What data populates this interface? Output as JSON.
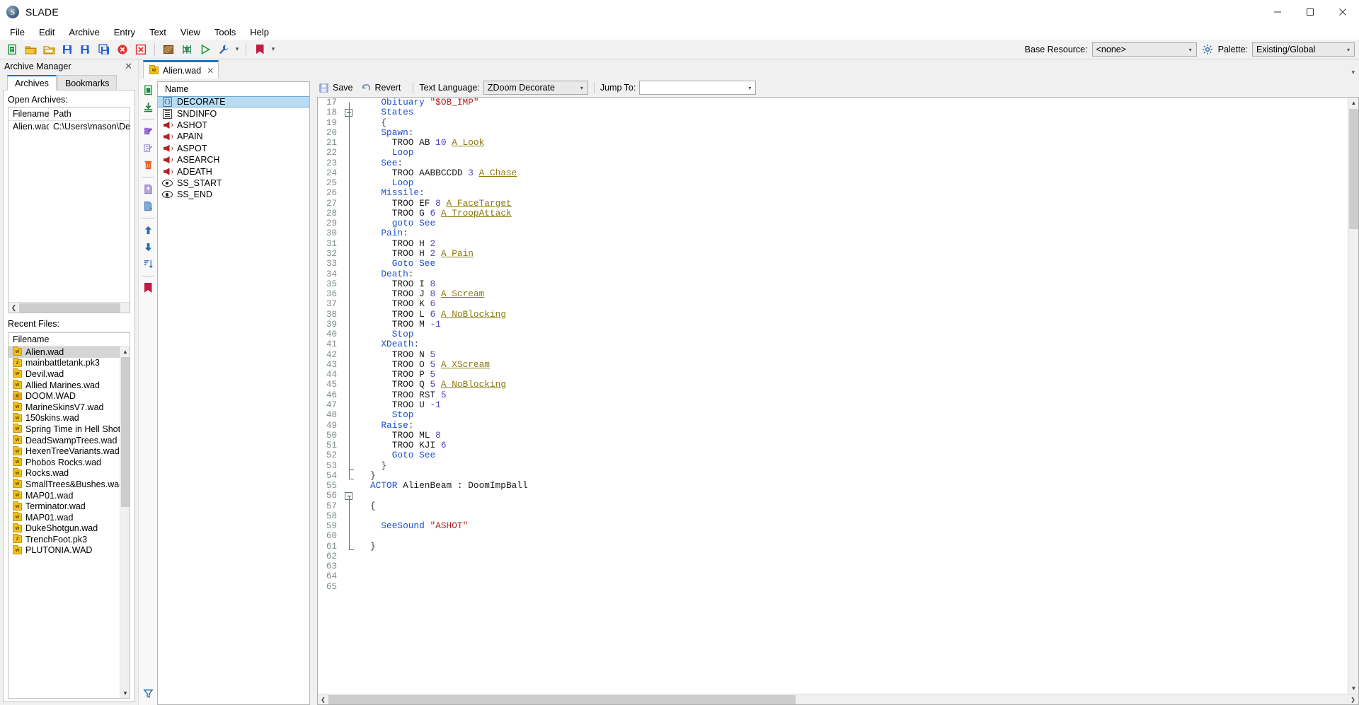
{
  "window": {
    "title": "SLADE",
    "app_icon": "slade-logo-icon",
    "buttons": {
      "minimize": "minimize-icon",
      "maximize": "maximize-icon",
      "close": "close-icon"
    }
  },
  "menubar": {
    "items": [
      "File",
      "Edit",
      "Archive",
      "Entry",
      "Text",
      "View",
      "Tools",
      "Help"
    ]
  },
  "toolbar": {
    "icons": [
      "new-archive-icon",
      "open-archive-icon",
      "open-folder-icon",
      "save-icon",
      "save-as-icon",
      "save-all-icon",
      "close-archive-icon",
      "close-all-icon",
      "texture-editor-icon",
      "map-editor-icon",
      "run-icon",
      "maintenance-icon",
      "bookmarks-icon"
    ],
    "base_resource_label": "Base Resource:",
    "base_resource_value": "<none>",
    "gear_icon": "gear-icon",
    "palette_label": "Palette:",
    "palette_value": "Existing/Global"
  },
  "archive_manager": {
    "title": "Archive Manager",
    "close_icon": "close-icon",
    "tabs": [
      {
        "label": "Archives",
        "active": true
      },
      {
        "label": "Bookmarks",
        "active": false
      }
    ],
    "open_archives": {
      "label": "Open Archives:",
      "columns": [
        "Filename",
        "Path"
      ],
      "rows": [
        {
          "filename": "Alien.wad",
          "path": "C:\\Users\\mason\\Desktop",
          "icon": "wad-file-icon"
        }
      ],
      "hscroll": {
        "left_arrow": "chevron-left-icon",
        "right_arrow": "chevron-right-icon"
      }
    },
    "recent_files": {
      "label": "Recent Files:",
      "columns": [
        "Filename"
      ],
      "rows": [
        {
          "name": "Alien.wad",
          "icon": "wad-file-icon",
          "badge": "w",
          "selected": true
        },
        {
          "name": "mainbattletank.pk3",
          "icon": "pk3-file-icon",
          "badge": "z",
          "selected": false
        },
        {
          "name": "Devil.wad",
          "icon": "wad-file-icon",
          "badge": "w",
          "selected": false
        },
        {
          "name": "Allied Marines.wad",
          "icon": "wad-file-icon",
          "badge": "w",
          "selected": false
        },
        {
          "name": "DOOM.WAD",
          "icon": "iwad-file-icon",
          "badge": "A",
          "selected": false
        },
        {
          "name": "MarineSkinsV7.wad",
          "icon": "wad-file-icon",
          "badge": "w",
          "selected": false
        },
        {
          "name": "150skins.wad",
          "icon": "wad-file-icon",
          "badge": "w",
          "selected": false
        },
        {
          "name": "Spring Time in Hell Shotgun.wa",
          "icon": "wad-file-icon",
          "badge": "w",
          "selected": false
        },
        {
          "name": "DeadSwampTrees.wad",
          "icon": "wad-file-icon",
          "badge": "w",
          "selected": false
        },
        {
          "name": "HexenTreeVariants.wad",
          "icon": "wad-file-icon",
          "badge": "w",
          "selected": false
        },
        {
          "name": "Phobos Rocks.wad",
          "icon": "wad-file-icon",
          "badge": "w",
          "selected": false
        },
        {
          "name": "Rocks.wad",
          "icon": "wad-file-icon",
          "badge": "w",
          "selected": false
        },
        {
          "name": "SmallTrees&Bushes.wad",
          "icon": "wad-file-icon",
          "badge": "w",
          "selected": false
        },
        {
          "name": "MAP01.wad",
          "icon": "wad-file-icon",
          "badge": "w",
          "selected": false
        },
        {
          "name": "Terminator.wad",
          "icon": "wad-file-icon",
          "badge": "w",
          "selected": false
        },
        {
          "name": "MAP01.wad",
          "icon": "wad-file-icon",
          "badge": "w",
          "selected": false
        },
        {
          "name": "DukeShotgun.wad",
          "icon": "wad-file-icon",
          "badge": "w",
          "selected": false
        },
        {
          "name": "TrenchFoot.pk3",
          "icon": "pk3-file-icon",
          "badge": "z",
          "selected": false
        },
        {
          "name": "PLUTONIA.WAD",
          "icon": "wad-file-icon",
          "badge": "w",
          "selected": false
        }
      ]
    }
  },
  "archive_tab": {
    "label": "Alien.wad",
    "icon": "wad-file-icon",
    "close_icon": "close-icon",
    "collapse_icon": "chevron-down-icon"
  },
  "entry_toolbar": {
    "icons": [
      "new-entry-icon",
      "import-entry-icon",
      "rename-entry-icon",
      "edit-entry-icon",
      "delete-entry-icon",
      "export-entry-icon",
      "export-entry-as-icon",
      "move-up-icon",
      "move-down-icon",
      "sort-icon",
      "bookmark-icon",
      "filter-icon"
    ]
  },
  "entry_list": {
    "column": "Name",
    "entries": [
      {
        "name": "DECORATE",
        "icon": "code-entry-icon",
        "selected": true
      },
      {
        "name": "SNDINFO",
        "icon": "text-entry-icon",
        "selected": false
      },
      {
        "name": "ASHOT",
        "icon": "sound-entry-icon",
        "selected": false
      },
      {
        "name": "APAIN",
        "icon": "sound-entry-icon",
        "selected": false
      },
      {
        "name": "ASPOT",
        "icon": "sound-entry-icon",
        "selected": false
      },
      {
        "name": "ASEARCH",
        "icon": "sound-entry-icon",
        "selected": false
      },
      {
        "name": "ADEATH",
        "icon": "sound-entry-icon",
        "selected": false
      },
      {
        "name": "SS_START",
        "icon": "marker-entry-icon",
        "selected": false
      },
      {
        "name": "SS_END",
        "icon": "marker-entry-icon",
        "selected": false
      }
    ]
  },
  "editor_toolbar": {
    "save_label": "Save",
    "save_icon": "save-icon",
    "revert_label": "Revert",
    "revert_icon": "revert-icon",
    "language_label": "Text Language:",
    "language_value": "ZDoom Decorate",
    "jump_to_label": "Jump To:",
    "jump_to_value": ""
  },
  "code": {
    "first_line": 17,
    "last_line": 65,
    "lines": [
      {
        "n": 17,
        "tokens": [
          {
            "t": "Obituary ",
            "c": "kw"
          },
          {
            "t": "\"$OB_IMP\"",
            "c": "str"
          }
        ],
        "indent": 1
      },
      {
        "n": 18,
        "tokens": [
          {
            "t": "States",
            "c": "kw"
          }
        ],
        "indent": 1,
        "fold": "open"
      },
      {
        "n": 19,
        "tokens": [
          {
            "t": "{",
            "c": "punct"
          }
        ],
        "indent": 1
      },
      {
        "n": 20,
        "tokens": [
          {
            "t": "Spawn",
            "c": "kw"
          },
          {
            "t": ":",
            "c": "punct"
          }
        ],
        "indent": 1
      },
      {
        "n": 21,
        "tokens": [
          {
            "t": "TROO AB ",
            "c": "plain"
          },
          {
            "t": "10",
            "c": "num"
          },
          {
            "t": " ",
            "c": "plain"
          },
          {
            "t": "A_Look",
            "c": "fn"
          }
        ],
        "indent": 2
      },
      {
        "n": 22,
        "tokens": [
          {
            "t": "Loop",
            "c": "kw"
          }
        ],
        "indent": 2
      },
      {
        "n": 23,
        "tokens": [
          {
            "t": "See",
            "c": "kw"
          },
          {
            "t": ":",
            "c": "punct"
          }
        ],
        "indent": 1
      },
      {
        "n": 24,
        "tokens": [
          {
            "t": "TROO AABBCCDD ",
            "c": "plain"
          },
          {
            "t": "3",
            "c": "num"
          },
          {
            "t": " ",
            "c": "plain"
          },
          {
            "t": "A_Chase",
            "c": "fn"
          }
        ],
        "indent": 2
      },
      {
        "n": 25,
        "tokens": [
          {
            "t": "Loop",
            "c": "kw"
          }
        ],
        "indent": 2
      },
      {
        "n": 26,
        "tokens": [
          {
            "t": "Missile",
            "c": "kw"
          },
          {
            "t": ":",
            "c": "punct"
          }
        ],
        "indent": 1
      },
      {
        "n": 27,
        "tokens": [
          {
            "t": "TROO EF ",
            "c": "plain"
          },
          {
            "t": "8",
            "c": "num"
          },
          {
            "t": " ",
            "c": "plain"
          },
          {
            "t": "A_FaceTarget",
            "c": "fn"
          }
        ],
        "indent": 2
      },
      {
        "n": 28,
        "tokens": [
          {
            "t": "TROO G ",
            "c": "plain"
          },
          {
            "t": "6",
            "c": "num"
          },
          {
            "t": " ",
            "c": "plain"
          },
          {
            "t": "A_TroopAttack",
            "c": "fn"
          }
        ],
        "indent": 2
      },
      {
        "n": 29,
        "tokens": [
          {
            "t": "goto ",
            "c": "kw"
          },
          {
            "t": "See",
            "c": "kw"
          }
        ],
        "indent": 2
      },
      {
        "n": 30,
        "tokens": [
          {
            "t": "Pain",
            "c": "kw"
          },
          {
            "t": ":",
            "c": "punct"
          }
        ],
        "indent": 1
      },
      {
        "n": 31,
        "tokens": [
          {
            "t": "TROO H ",
            "c": "plain"
          },
          {
            "t": "2",
            "c": "num"
          }
        ],
        "indent": 2
      },
      {
        "n": 32,
        "tokens": [
          {
            "t": "TROO H ",
            "c": "plain"
          },
          {
            "t": "2",
            "c": "num"
          },
          {
            "t": " ",
            "c": "plain"
          },
          {
            "t": "A_Pain",
            "c": "fn"
          }
        ],
        "indent": 2
      },
      {
        "n": 33,
        "tokens": [
          {
            "t": "Goto ",
            "c": "kw"
          },
          {
            "t": "See",
            "c": "kw"
          }
        ],
        "indent": 2
      },
      {
        "n": 34,
        "tokens": [
          {
            "t": "Death",
            "c": "kw"
          },
          {
            "t": ":",
            "c": "punct"
          }
        ],
        "indent": 1
      },
      {
        "n": 35,
        "tokens": [
          {
            "t": "TROO I ",
            "c": "plain"
          },
          {
            "t": "8",
            "c": "num"
          }
        ],
        "indent": 2
      },
      {
        "n": 36,
        "tokens": [
          {
            "t": "TROO J ",
            "c": "plain"
          },
          {
            "t": "8",
            "c": "num"
          },
          {
            "t": " ",
            "c": "plain"
          },
          {
            "t": "A_Scream",
            "c": "fn"
          }
        ],
        "indent": 2
      },
      {
        "n": 37,
        "tokens": [
          {
            "t": "TROO K ",
            "c": "plain"
          },
          {
            "t": "6",
            "c": "num"
          }
        ],
        "indent": 2
      },
      {
        "n": 38,
        "tokens": [
          {
            "t": "TROO L ",
            "c": "plain"
          },
          {
            "t": "6",
            "c": "num"
          },
          {
            "t": " ",
            "c": "plain"
          },
          {
            "t": "A_NoBlocking",
            "c": "fn"
          }
        ],
        "indent": 2
      },
      {
        "n": 39,
        "tokens": [
          {
            "t": "TROO M ",
            "c": "plain"
          },
          {
            "t": "-1",
            "c": "num"
          }
        ],
        "indent": 2
      },
      {
        "n": 40,
        "tokens": [
          {
            "t": "Stop",
            "c": "kw"
          }
        ],
        "indent": 2
      },
      {
        "n": 41,
        "tokens": [
          {
            "t": "XDeath",
            "c": "kw"
          },
          {
            "t": ":",
            "c": "punct"
          }
        ],
        "indent": 1
      },
      {
        "n": 42,
        "tokens": [
          {
            "t": "TROO N ",
            "c": "plain"
          },
          {
            "t": "5",
            "c": "num"
          }
        ],
        "indent": 2
      },
      {
        "n": 43,
        "tokens": [
          {
            "t": "TROO O ",
            "c": "plain"
          },
          {
            "t": "5",
            "c": "num"
          },
          {
            "t": " ",
            "c": "plain"
          },
          {
            "t": "A_XScream",
            "c": "fn"
          }
        ],
        "indent": 2
      },
      {
        "n": 44,
        "tokens": [
          {
            "t": "TROO P ",
            "c": "plain"
          },
          {
            "t": "5",
            "c": "num"
          }
        ],
        "indent": 2
      },
      {
        "n": 45,
        "tokens": [
          {
            "t": "TROO Q ",
            "c": "plain"
          },
          {
            "t": "5",
            "c": "num"
          },
          {
            "t": " ",
            "c": "plain"
          },
          {
            "t": "A_NoBlocking",
            "c": "fn"
          }
        ],
        "indent": 2
      },
      {
        "n": 46,
        "tokens": [
          {
            "t": "TROO RST ",
            "c": "plain"
          },
          {
            "t": "5",
            "c": "num"
          }
        ],
        "indent": 2
      },
      {
        "n": 47,
        "tokens": [
          {
            "t": "TROO U ",
            "c": "plain"
          },
          {
            "t": "-1",
            "c": "num"
          }
        ],
        "indent": 2
      },
      {
        "n": 48,
        "tokens": [
          {
            "t": "Stop",
            "c": "kw"
          }
        ],
        "indent": 2
      },
      {
        "n": 49,
        "tokens": [
          {
            "t": "Raise",
            "c": "kw"
          },
          {
            "t": ":",
            "c": "punct"
          }
        ],
        "indent": 1
      },
      {
        "n": 50,
        "tokens": [
          {
            "t": "TROO ML ",
            "c": "plain"
          },
          {
            "t": "8",
            "c": "num"
          }
        ],
        "indent": 2
      },
      {
        "n": 51,
        "tokens": [
          {
            "t": "TROO KJI ",
            "c": "plain"
          },
          {
            "t": "6",
            "c": "num"
          }
        ],
        "indent": 2
      },
      {
        "n": 52,
        "tokens": [
          {
            "t": "Goto ",
            "c": "kw"
          },
          {
            "t": "See",
            "c": "kw"
          }
        ],
        "indent": 2
      },
      {
        "n": 53,
        "tokens": [
          {
            "t": "}",
            "c": "punct"
          }
        ],
        "indent": 1,
        "fold": "end"
      },
      {
        "n": 54,
        "tokens": [
          {
            "t": "}",
            "c": "punct"
          }
        ],
        "indent": 0,
        "fold": "end"
      },
      {
        "n": 55,
        "tokens": [
          {
            "t": "ACTOR ",
            "c": "kw"
          },
          {
            "t": "AlienBeam : DoomImpBall",
            "c": "plain"
          }
        ],
        "indent": 0
      },
      {
        "n": 56,
        "tokens": [],
        "indent": 0,
        "fold": "open"
      },
      {
        "n": 57,
        "tokens": [
          {
            "t": "{",
            "c": "punct"
          }
        ],
        "indent": 0
      },
      {
        "n": 58,
        "tokens": [],
        "indent": 0
      },
      {
        "n": 59,
        "tokens": [
          {
            "t": "SeeSound ",
            "c": "kw"
          },
          {
            "t": "\"ASHOT\"",
            "c": "str"
          }
        ],
        "indent": 1
      },
      {
        "n": 60,
        "tokens": [],
        "indent": 0
      },
      {
        "n": 61,
        "tokens": [
          {
            "t": "}",
            "c": "punct"
          }
        ],
        "indent": 0,
        "fold": "end"
      },
      {
        "n": 62,
        "tokens": [],
        "indent": 0
      },
      {
        "n": 63,
        "tokens": [],
        "indent": 0
      },
      {
        "n": 64,
        "tokens": [],
        "indent": 0
      },
      {
        "n": 65,
        "tokens": [],
        "indent": 0
      }
    ],
    "scroll": {
      "up_arrow": "chevron-up-icon",
      "down_arrow": "chevron-down-icon",
      "left_arrow": "chevron-left-icon",
      "right_arrow": "chevron-right-icon"
    }
  },
  "colors": {
    "accent": "#1278c8",
    "selection": "#b8dcf4",
    "keyword": "#1a4fd0",
    "number": "#5a3fc0",
    "function": "#8a7a10",
    "string": "#b02020",
    "gutter_text": "#7d8b8b",
    "file_icon": "#f2c018"
  }
}
